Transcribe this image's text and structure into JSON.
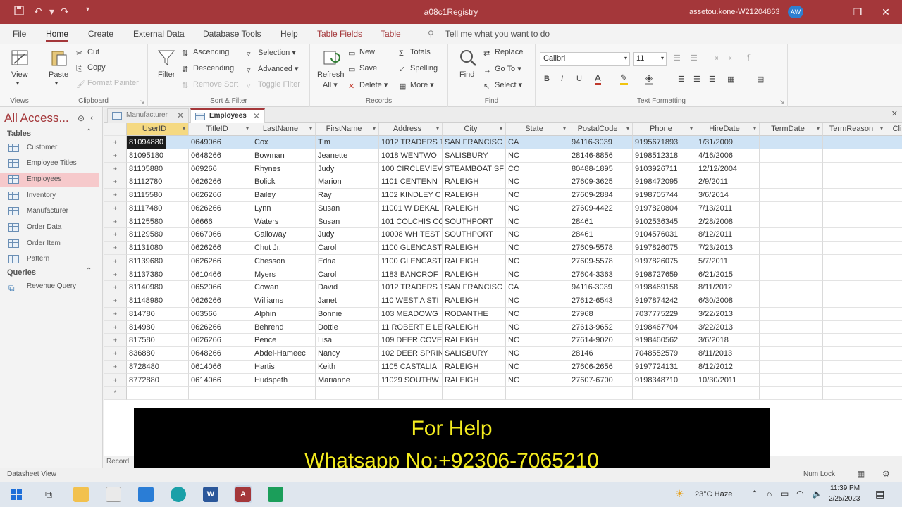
{
  "window": {
    "title": "a08c1Registry",
    "account": "assetou.kone-W21204863",
    "avatar": "AW",
    "qa_icons": [
      "save-icon",
      "undo-icon",
      "redo-icon",
      "customize-icon"
    ]
  },
  "menu_tabs": [
    "File",
    "Home",
    "Create",
    "External Data",
    "Database Tools",
    "Help",
    "Table Fields",
    "Table"
  ],
  "tell_me": "Tell me what you want to do",
  "ribbon": {
    "views": {
      "label": "Views",
      "view": "View"
    },
    "clipboard": {
      "label": "Clipboard",
      "paste": "Paste",
      "cut": "Cut",
      "copy": "Copy",
      "format_painter": "Format Painter"
    },
    "sort_filter": {
      "label": "Sort & Filter",
      "filter": "Filter",
      "ascending": "Ascending",
      "descending": "Descending",
      "remove_sort": "Remove Sort",
      "selection": "Selection",
      "advanced": "Advanced",
      "toggle_filter": "Toggle Filter"
    },
    "records": {
      "label": "Records",
      "refresh": "Refresh",
      "refresh_all": "All",
      "new": "New",
      "save": "Save",
      "delete": "Delete",
      "totals": "Totals",
      "spelling": "Spelling",
      "more": "More"
    },
    "find": {
      "label": "Find",
      "find": "Find",
      "replace": "Replace",
      "goto": "Go To",
      "select": "Select"
    },
    "text_formatting": {
      "label": "Text Formatting",
      "font": "Calibri",
      "size": "11",
      "bold": "B",
      "italic": "I",
      "underline": "U",
      "font_color": "A"
    }
  },
  "nav": {
    "header": "All Access...",
    "tables_label": "Tables",
    "tables": [
      "Customer",
      "Employee Titles",
      "Employees",
      "Inventory",
      "Manufacturer",
      "Order Data",
      "Order Item",
      "Pattern"
    ],
    "selected": "Employees",
    "queries_label": "Queries",
    "queries": [
      "Revenue Query"
    ]
  },
  "doc_tabs": [
    "Manufacturer",
    "Employees"
  ],
  "grid": {
    "columns": [
      "UserID",
      "TitleID",
      "LastName",
      "FirstName",
      "Address",
      "City",
      "State",
      "PostalCode",
      "Phone",
      "HireDate",
      "TermDate",
      "TermReason",
      "Cli"
    ],
    "rows": [
      [
        "81094880",
        "0649066",
        "Cox",
        "Tim",
        "1012 TRADERS T",
        "SAN FRANCISC",
        "CA",
        "94116-3039",
        "9195671893",
        "1/31/2009"
      ],
      [
        "81095180",
        "0648266",
        "Bowman",
        "Jeanette",
        "1018 WENTWO",
        "SALISBURY",
        "NC",
        "28146-8856",
        "9198512318",
        "4/16/2006"
      ],
      [
        "81105880",
        "069266",
        "Rhynes",
        "Judy",
        "100 CIRCLEVIEV",
        "STEAMBOAT SF",
        "CO",
        "80488-1895",
        "9103926711",
        "12/12/2004"
      ],
      [
        "81112780",
        "0626266",
        "Bolick",
        "Marion",
        "1101 CENTENN",
        "RALEIGH",
        "NC",
        "27609-3625",
        "9198472095",
        "2/9/2011"
      ],
      [
        "81115580",
        "0626266",
        "Bailey",
        "Ray",
        "1102 KINDLEY C",
        "RALEIGH",
        "NC",
        "27609-2884",
        "9198705744",
        "3/6/2014"
      ],
      [
        "81117480",
        "0626266",
        "Lynn",
        "Susan",
        "11001 W DEKAL",
        "RALEIGH",
        "NC",
        "27609-4422",
        "9197820804",
        "7/13/2011"
      ],
      [
        "81125580",
        "06666",
        "Waters",
        "Susan",
        "101 COLCHIS CC",
        "SOUTHPORT",
        "NC",
        "28461",
        "9102536345",
        "2/28/2008"
      ],
      [
        "81129580",
        "0667066",
        "Galloway",
        "Judy",
        "10008 WHITEST",
        "SOUTHPORT",
        "NC",
        "28461",
        "9104576031",
        "8/12/2011"
      ],
      [
        "81131080",
        "0626266",
        "Chut Jr.",
        "Carol",
        "1100 GLENCAST",
        "RALEIGH",
        "NC",
        "27609-5578",
        "9197826075",
        "7/23/2013"
      ],
      [
        "81139680",
        "0626266",
        "Chesson",
        "Edna",
        "1100 GLENCAST",
        "RALEIGH",
        "NC",
        "27609-5578",
        "9197826075",
        "5/7/2011"
      ],
      [
        "81137380",
        "0610466",
        "Myers",
        "Carol",
        "1183 BANCROF",
        "RALEIGH",
        "NC",
        "27604-3363",
        "9198727659",
        "6/21/2015"
      ],
      [
        "81140980",
        "0652066",
        "Cowan",
        "David",
        "1012 TRADERS T",
        "SAN FRANCISC",
        "CA",
        "94116-3039",
        "9198469158",
        "8/11/2012"
      ],
      [
        "81148980",
        "0626266",
        "Williams",
        "Janet",
        "110 WEST A STI",
        "RALEIGH",
        "NC",
        "27612-6543",
        "9197874242",
        "6/30/2008"
      ],
      [
        "814780",
        "063566",
        "Alphin",
        "Bonnie",
        "103 MEADOWG",
        "RODANTHE",
        "NC",
        "27968",
        "7037775229",
        "3/22/2013"
      ],
      [
        "814980",
        "0626266",
        "Behrend",
        "Dottie",
        "11 ROBERT E LE",
        "RALEIGH",
        "NC",
        "27613-9652",
        "9198467704",
        "3/22/2013"
      ],
      [
        "817580",
        "0626266",
        "Pence",
        "Lisa",
        "109 DEER COVE",
        "RALEIGH",
        "NC",
        "27614-9020",
        "9198460562",
        "3/6/2018"
      ],
      [
        "836880",
        "0648266",
        "Abdel-Hameec",
        "Nancy",
        "102 DEER SPRIN",
        "SALISBURY",
        "NC",
        "28146",
        "7048552579",
        "8/11/2013"
      ],
      [
        "8728480",
        "0614066",
        "Hartis",
        "Keith",
        "1105 CASTALIA",
        "RALEIGH",
        "NC",
        "27606-2656",
        "9197724131",
        "8/12/2012"
      ],
      [
        "8772880",
        "0614066",
        "Hudspeth",
        "Marianne",
        "11029 SOUTHW",
        "RALEIGH",
        "NC",
        "27607-6700",
        "9198348710",
        "10/30/2011"
      ]
    ],
    "new_row_marker": "*",
    "row_marker": "+"
  },
  "record_label": "Record",
  "caption": {
    "line1": "For Help",
    "line2": "Whatsapp No:+92306-7065210"
  },
  "status": {
    "left": "Datasheet View",
    "numlock": "Num Lock"
  },
  "taskbar": {
    "weather": "23°C  Haze",
    "time": "11:39 PM",
    "date": "2/25/2023"
  },
  "colors": {
    "accent": "#a4373a",
    "selected_nav": "#f6c9cb",
    "row_highlight": "#cfe3f5",
    "header_selected": "#f5d982",
    "caption_text": "#f4ec1e"
  }
}
